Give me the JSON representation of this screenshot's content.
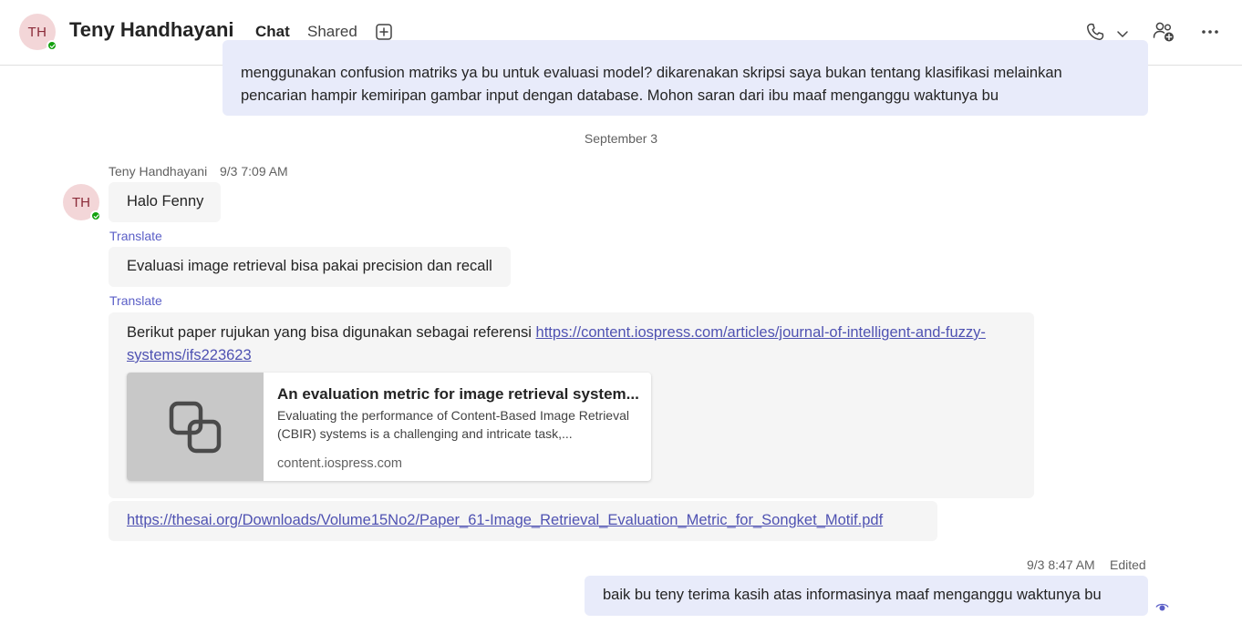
{
  "header": {
    "avatar_initials": "TH",
    "contact_name": "Teny Handhayani",
    "tabs": [
      {
        "label": "Chat",
        "active": true
      },
      {
        "label": "Shared",
        "active": false
      }
    ],
    "icons": [
      "add-tab-icon",
      "phone-icon",
      "chevron-down-icon",
      "add-people-icon",
      "more-options-icon"
    ],
    "accent_color": "#5b5fc7",
    "presence_color": "#13a10e"
  },
  "messages": {
    "top_sent": {
      "text": "menggunakan confusion matriks ya bu untuk evaluasi model? dikarenakan skripsi saya bukan tentang klasifikasi melainkan pencarian hampir kemiripan gambar input dengan database. Mohon saran dari ibu maaf menganggu waktunya bu"
    },
    "date_divider": "September 3",
    "received_group": {
      "sender": "Teny Handhayani",
      "timestamp": "9/3 7:09 AM",
      "avatar_initials": "TH",
      "msg1": "Halo Fenny",
      "translate_label": "Translate",
      "msg2": "Evaluasi image retrieval bisa pakai precision dan recall",
      "msg3_text": "Berikut paper rujukan yang bisa digunakan sebagai referensi ",
      "msg3_link": "https://content.iospress.com/articles/journal-of-intelligent-and-fuzzy-systems/ifs223623",
      "preview": {
        "title": "An evaluation metric for image retrieval system...",
        "description": " Evaluating the performance of Content-Based Image Retrieval (CBIR) systems is a challenging and intricate task,...",
        "domain": "content.iospress.com",
        "icon": "link-icon"
      },
      "msg4_link": "https://thesai.org/Downloads/Volume15No2/Paper_61-Image_Retrieval_Evaluation_Metric_for_Songket_Motif.pdf"
    },
    "sent_last": {
      "timestamp": "9/3 8:47 AM",
      "edited_label": "Edited",
      "text": "baik bu teny terima kasih atas informasinya maaf menganggu waktunya bu",
      "read_icon": "seen-eye-icon"
    }
  }
}
